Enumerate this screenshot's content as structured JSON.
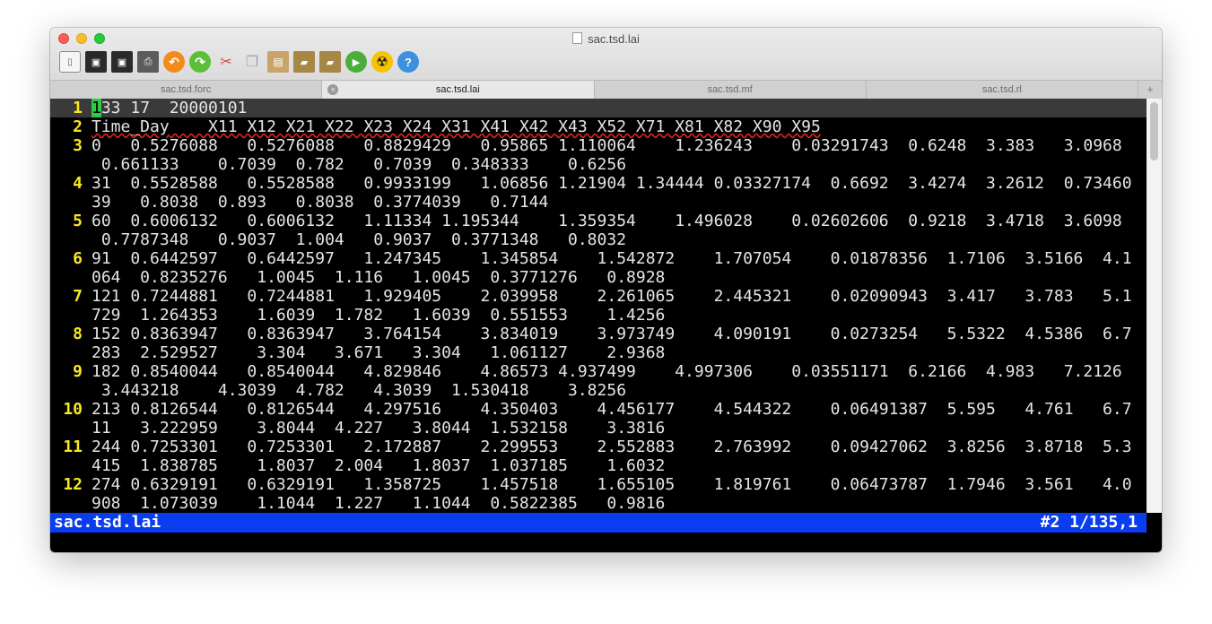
{
  "window": {
    "title": "sac.tsd.lai"
  },
  "toolbar": {
    "items": [
      {
        "name": "new-file",
        "glyph": "▯"
      },
      {
        "name": "save",
        "glyph": "▣"
      },
      {
        "name": "save-all",
        "glyph": "▣"
      },
      {
        "name": "print",
        "glyph": "⎙"
      },
      {
        "name": "undo",
        "glyph": "↶"
      },
      {
        "name": "redo",
        "glyph": "↷"
      },
      {
        "name": "cut",
        "glyph": "✂"
      },
      {
        "name": "copy",
        "glyph": "❐"
      },
      {
        "name": "paste",
        "glyph": "▤"
      },
      {
        "name": "open-folder",
        "glyph": "▰"
      },
      {
        "name": "new-folder",
        "glyph": "▰"
      },
      {
        "name": "run",
        "glyph": "▶"
      },
      {
        "name": "hazard",
        "glyph": "☢"
      },
      {
        "name": "help",
        "glyph": "?"
      }
    ]
  },
  "tabs": [
    {
      "label": "sac.tsd.forc",
      "active": false
    },
    {
      "label": "sac.tsd.lai",
      "active": true
    },
    {
      "label": "sac.tsd.mf",
      "active": false
    },
    {
      "label": "sac.tsd.rl",
      "active": false
    }
  ],
  "tab_glyphs": {
    "close": "×",
    "add": "+"
  },
  "editor": {
    "cursor_char": "1",
    "line1_rest": "33 17  20000101",
    "line2_first": "Time_Day",
    "line2_rest": "    X11 X12 X21 X22 X23 X24 X31 X41 X42 X43 X52 X71 X81 X82 X90 X95",
    "rows": [
      {
        "num": "3",
        "a": "0   0.5276088   0.5276088   0.8829429   0.95865 1.110064    1.236243    0.03291743  0.6248  3.383   3.0968",
        "b": " 0.661133    0.7039  0.782   0.7039  0.348333    0.6256"
      },
      {
        "num": "4",
        "a": "31  0.5528588   0.5528588   0.9933199   1.06856 1.21904 1.34444 0.03327174  0.6692  3.4274  3.2612  0.73460",
        "b": "39   0.8038  0.893   0.8038  0.3774039   0.7144"
      },
      {
        "num": "5",
        "a": "60  0.6006132   0.6006132   1.11334 1.195344    1.359354    1.496028    0.02602606  0.9218  3.4718  3.6098",
        "b": " 0.7787348   0.9037  1.004   0.9037  0.3771348   0.8032"
      },
      {
        "num": "6",
        "a": "91  0.6442597   0.6442597   1.247345    1.345854    1.542872    1.707054    0.01878356  1.7106  3.5166  4.1",
        "b": "064  0.8235276   1.0045  1.116   1.0045  0.3771276   0.8928"
      },
      {
        "num": "7",
        "a": "121 0.7244881   0.7244881   1.929405    2.039958    2.261065    2.445321    0.02090943  3.417   3.783   5.1",
        "b": "729  1.264353    1.6039  1.782   1.6039  0.551553    1.4256"
      },
      {
        "num": "8",
        "a": "152 0.8363947   0.8363947   3.764154    3.834019    3.973749    4.090191    0.0273254   5.5322  4.5386  6.7",
        "b": "283  2.529527    3.304   3.671   3.304   1.061127    2.9368"
      },
      {
        "num": "9",
        "a": "182 0.8540044   0.8540044   4.829846    4.86573 4.937499    4.997306    0.03551171  6.2166  4.983   7.2126",
        "b": " 3.443218    4.3039  4.782   4.3039  1.530418    3.8256"
      },
      {
        "num": "10",
        "a": "213 0.8126544   0.8126544   4.297516    4.350403    4.456177    4.544322    0.06491387  5.595   4.761   6.7",
        "b": "11   3.222959    3.8044  4.227   3.8044  1.532158    3.3816"
      },
      {
        "num": "11",
        "a": "244 0.7253301   0.7253301   2.172887    2.299553    2.552883    2.763992    0.09427062  3.8256  3.8718  5.3",
        "b": "415  1.838785    1.8037  2.004   1.8037  1.037185    1.6032"
      },
      {
        "num": "12",
        "a": "274 0.6329191   0.6329191   1.358725    1.457518    1.655105    1.819761    0.06473787  1.7946  3.561   4.0",
        "b": "908  1.073039    1.1044  1.227   1.1044  0.5822385   0.9816"
      }
    ]
  },
  "status": {
    "filename": "sac.tsd.lai",
    "position": "#2 1/135,1"
  },
  "colors": {
    "status_bg": "#0a3cf0",
    "line_number": "#f8e71c",
    "cursor": "#2ecc40"
  }
}
